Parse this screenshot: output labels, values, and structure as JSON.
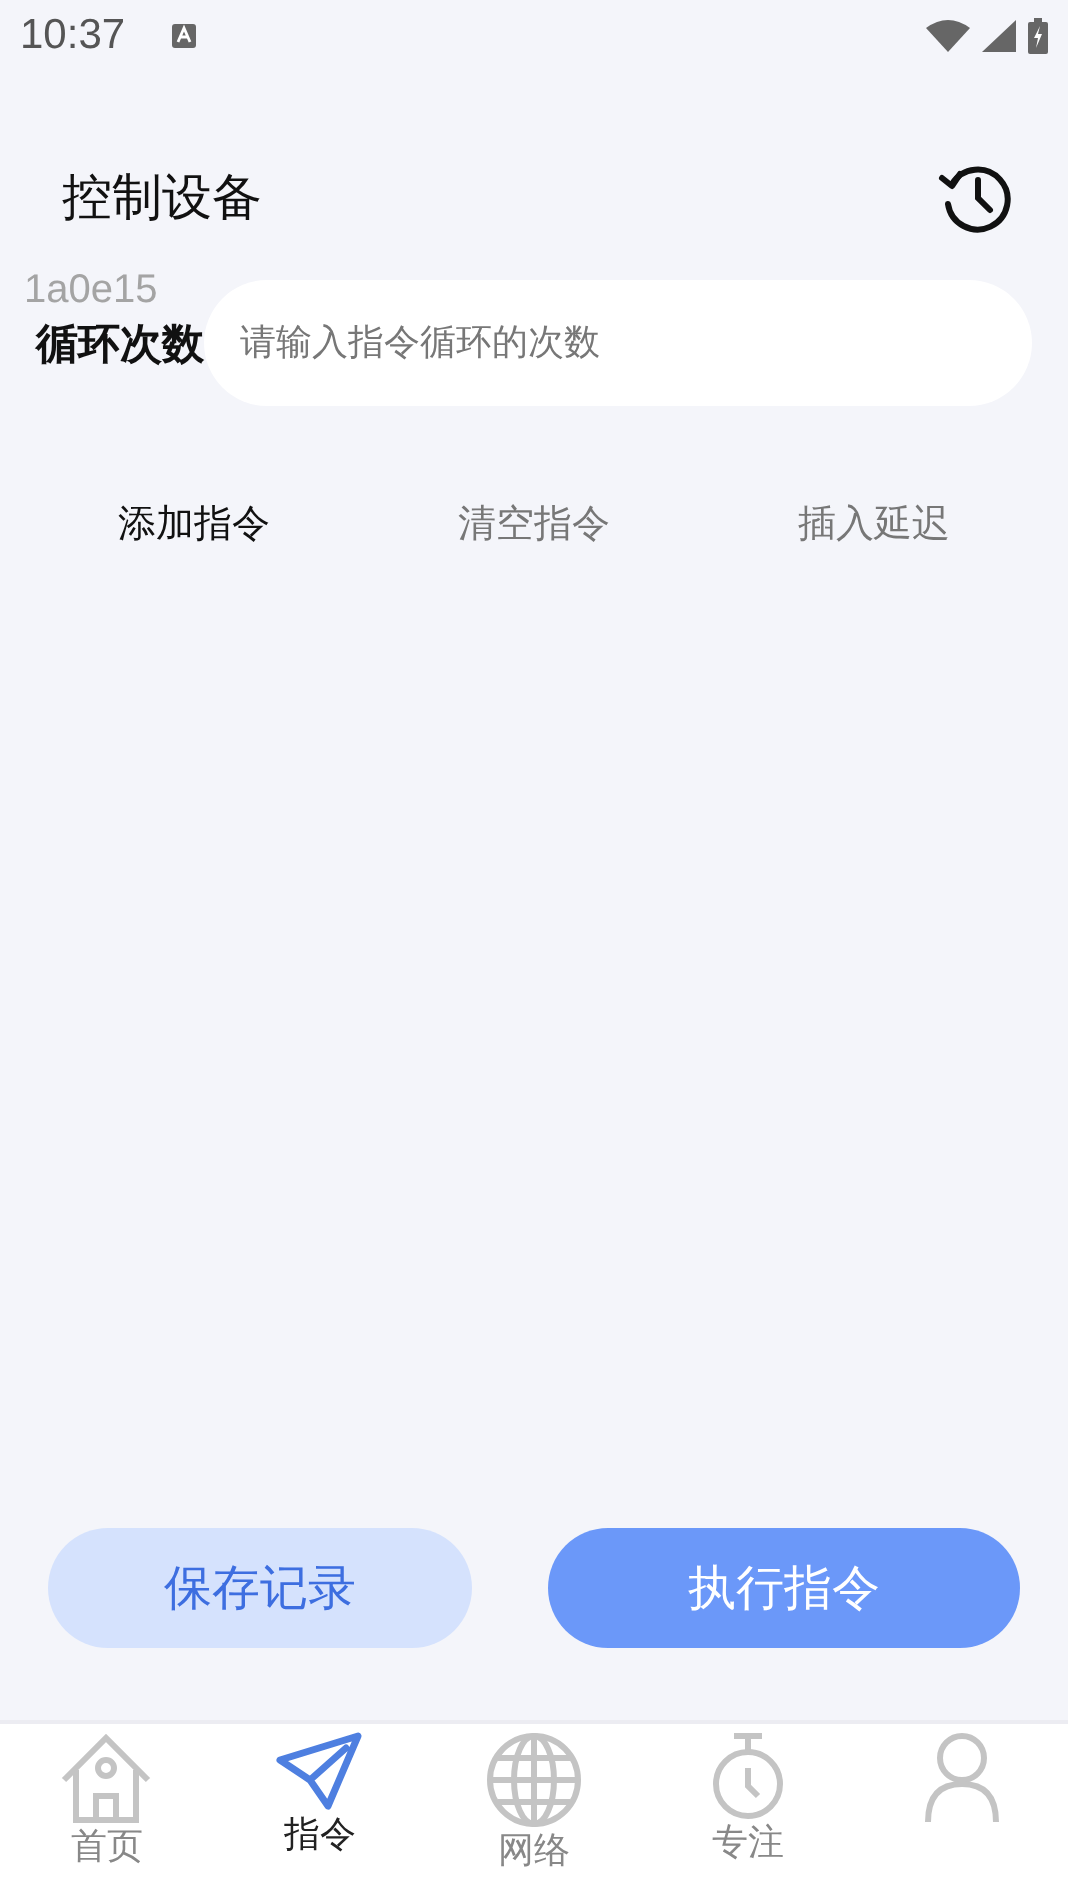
{
  "status_bar": {
    "time": "10:37"
  },
  "header": {
    "title": "控制设备"
  },
  "debug_label": "1a0e15",
  "loop_field": {
    "label": "循环次数",
    "placeholder": "请输入指令循环的次数"
  },
  "actions": [
    {
      "label": "添加指令",
      "disabled": false
    },
    {
      "label": "清空指令",
      "disabled": true
    },
    {
      "label": "插入延迟",
      "disabled": true
    }
  ],
  "buttons": [
    {
      "label": "保存记录",
      "kind": "secondary"
    },
    {
      "label": "执行指令",
      "kind": "primary"
    }
  ],
  "nav": [
    {
      "kind": "home",
      "label": "首页",
      "selected": false
    },
    {
      "kind": "send",
      "label": "指令",
      "selected": true
    },
    {
      "kind": "globe",
      "label": "网络",
      "selected": false
    },
    {
      "kind": "timer",
      "label": "专注",
      "selected": false
    },
    {
      "kind": "person",
      "selected": false
    }
  ]
}
